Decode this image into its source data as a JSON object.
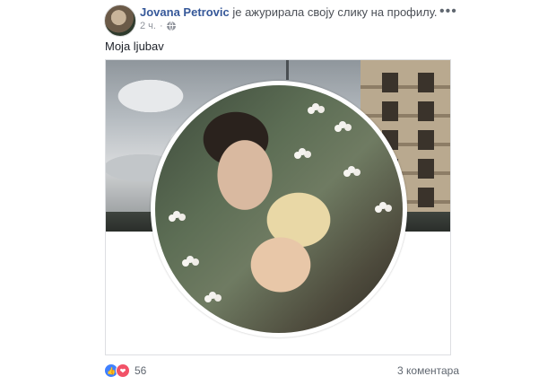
{
  "post": {
    "author": "Jovana Petrovic",
    "action": "је ажурирала своју слику на профилу.",
    "time": "2 ч.",
    "text": "Moja ljubav",
    "privacy_icon": "globe-icon",
    "more_icon": "ellipsis-icon"
  },
  "footer": {
    "reaction_icons": [
      "like-icon",
      "love-icon"
    ],
    "reaction_count": "56",
    "comments": "3 коментара"
  },
  "colors": {
    "author_link": "#365899",
    "like": "#4080ff",
    "love": "#f25268",
    "meta": "#90949c"
  }
}
